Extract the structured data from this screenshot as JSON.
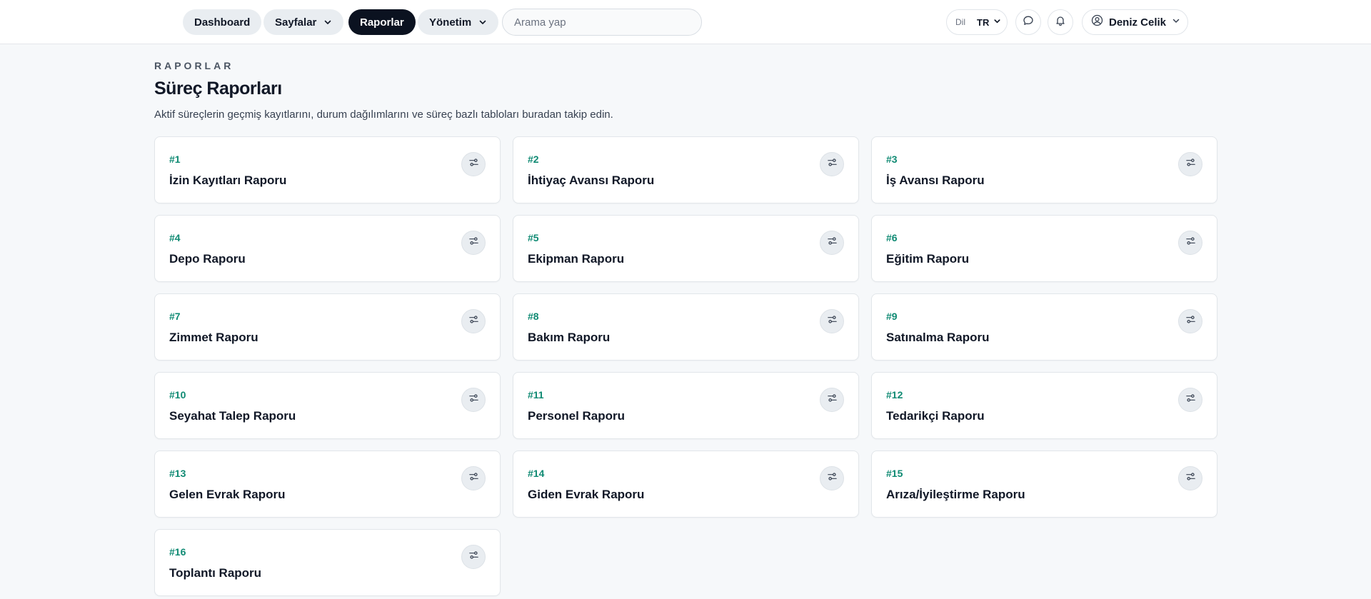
{
  "nav": {
    "dashboard": "Dashboard",
    "pages": "Sayfalar",
    "reports": "Raporlar",
    "management": "Yönetim",
    "search_placeholder": "Arama yap",
    "lang_label": "Dil",
    "lang_value": "TR",
    "user_name": "Deniz Celik"
  },
  "header": {
    "eyebrow": "RAPORLAR",
    "title": "Süreç Raporları",
    "description": "Aktif süreçlerin geçmiş kayıtlarını, durum dağılımlarını ve süreç bazlı tabloları buradan takip edin."
  },
  "colors": {
    "accent": "#0f8a73",
    "active_nav": "#0b1220"
  },
  "reports": [
    {
      "num": "#1",
      "title": "İzin Kayıtları Raporu"
    },
    {
      "num": "#2",
      "title": "İhtiyaç Avansı Raporu"
    },
    {
      "num": "#3",
      "title": "İş Avansı Raporu"
    },
    {
      "num": "#4",
      "title": "Depo Raporu"
    },
    {
      "num": "#5",
      "title": "Ekipman Raporu"
    },
    {
      "num": "#6",
      "title": "Eğitim Raporu"
    },
    {
      "num": "#7",
      "title": "Zimmet Raporu"
    },
    {
      "num": "#8",
      "title": "Bakım Raporu"
    },
    {
      "num": "#9",
      "title": "Satınalma Raporu"
    },
    {
      "num": "#10",
      "title": "Seyahat Talep Raporu"
    },
    {
      "num": "#11",
      "title": "Personel Raporu"
    },
    {
      "num": "#12",
      "title": "Tedarikçi Raporu"
    },
    {
      "num": "#13",
      "title": "Gelen Evrak Raporu"
    },
    {
      "num": "#14",
      "title": "Giden Evrak Raporu"
    },
    {
      "num": "#15",
      "title": "Arıza/İyileştirme Raporu"
    },
    {
      "num": "#16",
      "title": "Toplantı Raporu"
    }
  ]
}
